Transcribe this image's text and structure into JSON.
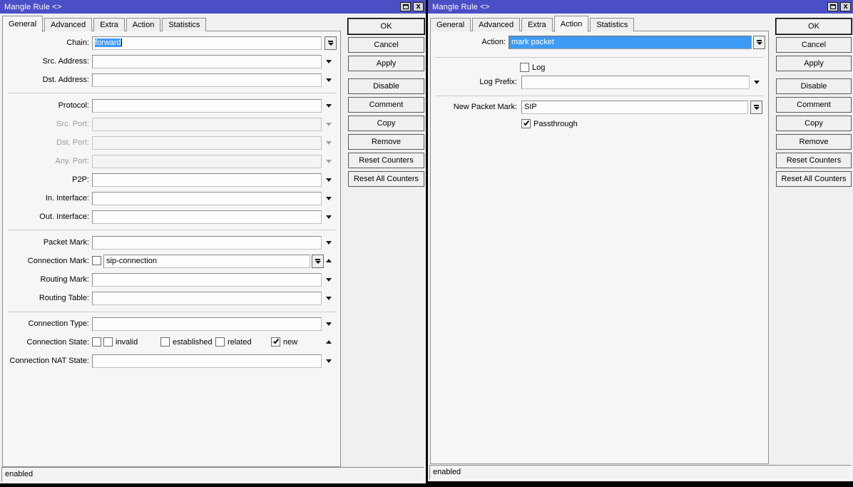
{
  "left_window": {
    "title": "Mangle Rule <>",
    "tabs": {
      "general": "General",
      "advanced": "Advanced",
      "extra": "Extra",
      "action": "Action",
      "statistics": "Statistics",
      "active_tab": "General"
    },
    "fields": {
      "chain": {
        "label": "Chain:",
        "value": "forward"
      },
      "src_address": {
        "label": "Src. Address:",
        "value": ""
      },
      "dst_address": {
        "label": "Dst. Address:",
        "value": ""
      },
      "protocol": {
        "label": "Protocol:",
        "value": ""
      },
      "src_port": {
        "label": "Src. Port:",
        "value": "",
        "disabled": true
      },
      "dst_port": {
        "label": "Dst. Port:",
        "value": "",
        "disabled": true
      },
      "any_port": {
        "label": "Any. Port:",
        "value": "",
        "disabled": true
      },
      "p2p": {
        "label": "P2P:",
        "value": ""
      },
      "in_interface": {
        "label": "In. Interface:",
        "value": ""
      },
      "out_interface": {
        "label": "Out. Interface:",
        "value": ""
      },
      "packet_mark": {
        "label": "Packet Mark:",
        "value": ""
      },
      "connection_mark": {
        "label": "Connection Mark:",
        "value": "sip-connection",
        "not_checkbox_checked": false
      },
      "routing_mark": {
        "label": "Routing Mark:",
        "value": ""
      },
      "routing_table": {
        "label": "Routing Table:",
        "value": ""
      },
      "connection_type": {
        "label": "Connection Type:",
        "value": ""
      },
      "connection_state": {
        "label": "Connection State:",
        "not_checkbox_checked": false,
        "options": [
          {
            "label": "invalid",
            "checked": false
          },
          {
            "label": "established",
            "checked": false
          },
          {
            "label": "related",
            "checked": false
          },
          {
            "label": "new",
            "checked": true
          }
        ]
      },
      "connection_nat_state": {
        "label": "Connection NAT State:",
        "value": ""
      }
    },
    "buttons": {
      "ok": "OK",
      "cancel": "Cancel",
      "apply": "Apply",
      "disable": "Disable",
      "comment": "Comment",
      "copy": "Copy",
      "remove": "Remove",
      "reset_counters": "Reset Counters",
      "reset_all_counters": "Reset All Counters"
    },
    "status": "enabled"
  },
  "right_window": {
    "title": "Mangle Rule <>",
    "tabs": {
      "general": "General",
      "advanced": "Advanced",
      "extra": "Extra",
      "action": "Action",
      "statistics": "Statistics",
      "active_tab": "Action"
    },
    "fields": {
      "action": {
        "label": "Action:",
        "value": "mark packet"
      },
      "log": {
        "label": "Log",
        "checked": false
      },
      "log_prefix": {
        "label": "Log Prefix:",
        "value": ""
      },
      "new_packet_mark": {
        "label": "New Packet Mark:",
        "value": "SIP"
      },
      "passthrough": {
        "label": "Passthrough",
        "checked": true
      }
    },
    "buttons": {
      "ok": "OK",
      "cancel": "Cancel",
      "apply": "Apply",
      "disable": "Disable",
      "comment": "Comment",
      "copy": "Copy",
      "remove": "Remove",
      "reset_counters": "Reset Counters",
      "reset_all_counters": "Reset All Counters"
    },
    "status": "enabled"
  }
}
